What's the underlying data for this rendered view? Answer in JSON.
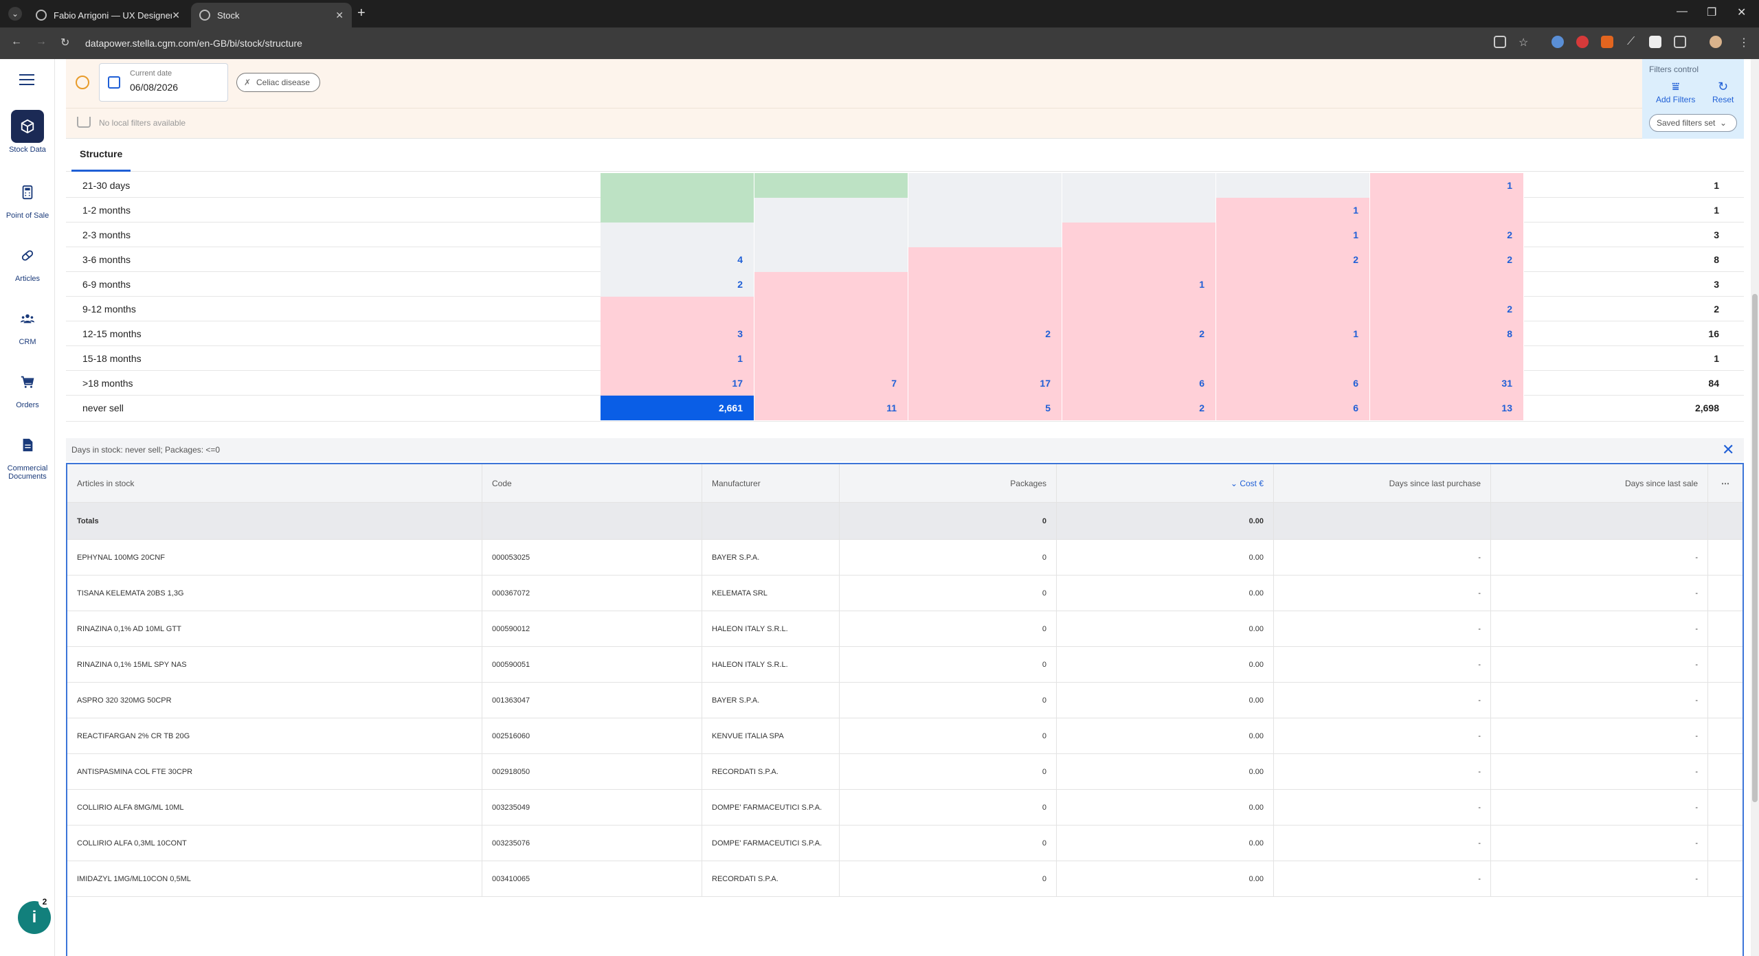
{
  "browser": {
    "tabs": [
      {
        "title": "Fabio Arrigoni — UX Designer.",
        "active": false
      },
      {
        "title": "Stock",
        "active": true
      }
    ],
    "url": "datapower.stella.cgm.com/en-GB/bi/stock/structure"
  },
  "sidebar": {
    "items": [
      {
        "label": "Stock Data",
        "icon": "cube-icon",
        "active": true
      },
      {
        "label": "Point of Sale",
        "icon": "calculator-icon",
        "active": false
      },
      {
        "label": "Articles",
        "icon": "pill-icon",
        "active": false
      },
      {
        "label": "CRM",
        "icon": "people-icon",
        "active": false
      },
      {
        "label": "Orders",
        "icon": "cart-icon",
        "active": false
      },
      {
        "label": "Commercial Documents",
        "icon": "document-icon",
        "active": false
      }
    ],
    "help_badge": "2"
  },
  "filters": {
    "date_label": "Current date",
    "date_value": "06/08/2026",
    "chip_label": "Celiac disease",
    "local_filters_text": "No local filters available",
    "control_label": "Filters control",
    "add_filters_label": "Add Filters",
    "reset_label": "Reset",
    "saved_filters_label": "Saved filters set"
  },
  "structure_tab": "Structure",
  "matrix": {
    "rows": [
      {
        "label": "21-30 days",
        "cells": [
          {
            "c": "g",
            "v": ""
          },
          {
            "c": "g",
            "v": ""
          },
          {
            "c": "l",
            "v": ""
          },
          {
            "c": "l",
            "v": ""
          },
          {
            "c": "l",
            "v": ""
          },
          {
            "c": "p",
            "v": "1"
          }
        ],
        "total": "1"
      },
      {
        "label": "1-2 months",
        "cells": [
          {
            "c": "g",
            "v": ""
          },
          {
            "c": "l",
            "v": ""
          },
          {
            "c": "l",
            "v": ""
          },
          {
            "c": "l",
            "v": ""
          },
          {
            "c": "p",
            "v": "1"
          },
          {
            "c": "p",
            "v": ""
          }
        ],
        "total": "1"
      },
      {
        "label": "2-3 months",
        "cells": [
          {
            "c": "l",
            "v": ""
          },
          {
            "c": "l",
            "v": ""
          },
          {
            "c": "l",
            "v": ""
          },
          {
            "c": "p",
            "v": ""
          },
          {
            "c": "p",
            "v": "1"
          },
          {
            "c": "p",
            "v": "2"
          }
        ],
        "total": "3"
      },
      {
        "label": "3-6 months",
        "cells": [
          {
            "c": "l",
            "v": "4"
          },
          {
            "c": "l",
            "v": ""
          },
          {
            "c": "p",
            "v": ""
          },
          {
            "c": "p",
            "v": ""
          },
          {
            "c": "p",
            "v": "2"
          },
          {
            "c": "p",
            "v": "2"
          }
        ],
        "total": "8"
      },
      {
        "label": "6-9 months",
        "cells": [
          {
            "c": "l",
            "v": "2"
          },
          {
            "c": "p",
            "v": ""
          },
          {
            "c": "p",
            "v": ""
          },
          {
            "c": "p",
            "v": "1"
          },
          {
            "c": "p",
            "v": ""
          },
          {
            "c": "p",
            "v": ""
          }
        ],
        "total": "3"
      },
      {
        "label": "9-12 months",
        "cells": [
          {
            "c": "p",
            "v": ""
          },
          {
            "c": "p",
            "v": ""
          },
          {
            "c": "p",
            "v": ""
          },
          {
            "c": "p",
            "v": ""
          },
          {
            "c": "p",
            "v": ""
          },
          {
            "c": "p",
            "v": "2"
          }
        ],
        "total": "2"
      },
      {
        "label": "12-15 months",
        "cells": [
          {
            "c": "p",
            "v": "3"
          },
          {
            "c": "p",
            "v": ""
          },
          {
            "c": "p",
            "v": "2"
          },
          {
            "c": "p",
            "v": "2"
          },
          {
            "c": "p",
            "v": "1"
          },
          {
            "c": "p",
            "v": "8"
          }
        ],
        "total": "16"
      },
      {
        "label": "15-18 months",
        "cells": [
          {
            "c": "p",
            "v": "1"
          },
          {
            "c": "p",
            "v": ""
          },
          {
            "c": "p",
            "v": ""
          },
          {
            "c": "p",
            "v": ""
          },
          {
            "c": "p",
            "v": ""
          },
          {
            "c": "p",
            "v": ""
          }
        ],
        "total": "1"
      },
      {
        "label": ">18 months",
        "cells": [
          {
            "c": "p",
            "v": "17"
          },
          {
            "c": "p",
            "v": "7"
          },
          {
            "c": "p",
            "v": "17"
          },
          {
            "c": "p",
            "v": "6"
          },
          {
            "c": "p",
            "v": "6"
          },
          {
            "c": "p",
            "v": "31"
          }
        ],
        "total": "84"
      },
      {
        "label": "never sell",
        "cells": [
          {
            "c": "b",
            "v": "2,661"
          },
          {
            "c": "p",
            "v": "11"
          },
          {
            "c": "p",
            "v": "5"
          },
          {
            "c": "p",
            "v": "2"
          },
          {
            "c": "p",
            "v": "6"
          },
          {
            "c": "p",
            "v": "13"
          }
        ],
        "total": "2,698"
      }
    ]
  },
  "detail": {
    "filter_text": "Days in stock: never sell;  Packages: <=0",
    "headers": {
      "articles": "Articles in stock",
      "code": "Code",
      "manufacturer": "Manufacturer",
      "packages": "Packages",
      "cost": "Cost €",
      "days_purchase": "Days since last purchase",
      "days_sale": "Days since last sale",
      "more": "⋯"
    },
    "totals": {
      "label": "Totals",
      "packages": "0",
      "cost": "0.00"
    },
    "rows": [
      {
        "article": "EPHYNAL 100MG 20CNF",
        "code": "000053025",
        "manufacturer": "BAYER S.P.A.",
        "packages": "0",
        "cost": "0.00",
        "purchase": "-",
        "sale": "-"
      },
      {
        "article": "TISANA KELEMATA 20BS 1,3G",
        "code": "000367072",
        "manufacturer": "KELEMATA SRL",
        "packages": "0",
        "cost": "0.00",
        "purchase": "-",
        "sale": "-"
      },
      {
        "article": "RINAZINA 0,1% AD 10ML GTT",
        "code": "000590012",
        "manufacturer": "HALEON ITALY S.R.L.",
        "packages": "0",
        "cost": "0.00",
        "purchase": "-",
        "sale": "-"
      },
      {
        "article": "RINAZINA 0,1% 15ML SPY NAS",
        "code": "000590051",
        "manufacturer": "HALEON ITALY S.R.L.",
        "packages": "0",
        "cost": "0.00",
        "purchase": "-",
        "sale": "-"
      },
      {
        "article": "ASPRO 320 320MG 50CPR",
        "code": "001363047",
        "manufacturer": "BAYER S.P.A.",
        "packages": "0",
        "cost": "0.00",
        "purchase": "-",
        "sale": "-"
      },
      {
        "article": "REACTIFARGAN 2% CR TB 20G",
        "code": "002516060",
        "manufacturer": "KENVUE ITALIA SPA",
        "packages": "0",
        "cost": "0.00",
        "purchase": "-",
        "sale": "-"
      },
      {
        "article": "ANTISPASMINA COL FTE 30CPR",
        "code": "002918050",
        "manufacturer": "RECORDATI S.P.A.",
        "packages": "0",
        "cost": "0.00",
        "purchase": "-",
        "sale": "-"
      },
      {
        "article": "COLLIRIO ALFA 8MG/ML 10ML",
        "code": "003235049",
        "manufacturer": "DOMPE' FARMACEUTICI S.P.A.",
        "packages": "0",
        "cost": "0.00",
        "purchase": "-",
        "sale": "-"
      },
      {
        "article": "COLLIRIO ALFA 0,3ML 10CONT",
        "code": "003235076",
        "manufacturer": "DOMPE' FARMACEUTICI S.P.A.",
        "packages": "0",
        "cost": "0.00",
        "purchase": "-",
        "sale": "-"
      },
      {
        "article": "IMIDAZYL 1MG/ML10CON 0,5ML",
        "code": "003410065",
        "manufacturer": "RECORDATI S.P.A.",
        "packages": "0",
        "cost": "0.00",
        "purchase": "-",
        "sale": "-"
      }
    ]
  }
}
